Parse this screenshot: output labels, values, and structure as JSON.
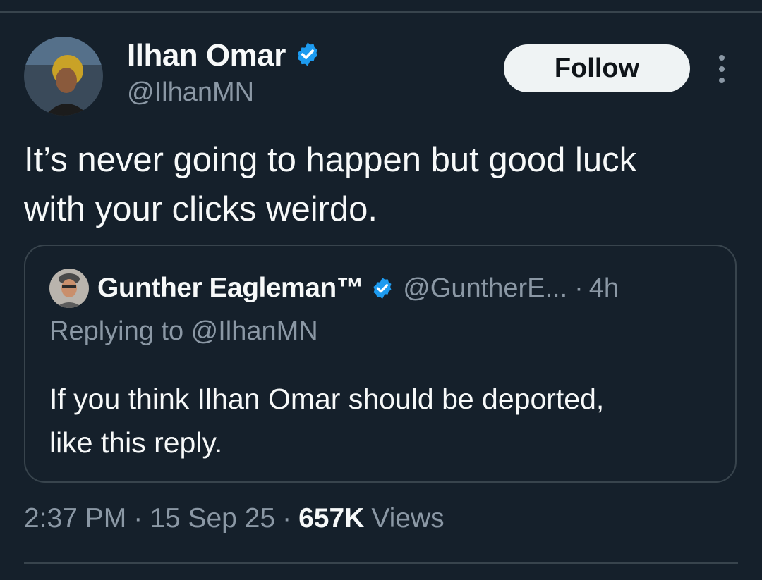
{
  "tweet": {
    "author": {
      "name": "Ilhan Omar",
      "handle": "@IlhanMN",
      "verified": true,
      "verified_color": "#1d9bf0"
    },
    "follow_label": "Follow",
    "more_icon": "more-horizontal-icon",
    "text_lines": [
      "It’s never going to happen but good luck",
      "with your clicks weirdo."
    ],
    "quoted": {
      "name": "Gunther Eagleman™",
      "verified": true,
      "handle": "@GuntherE...",
      "separator": "·",
      "time": "4h",
      "replying_to": "Replying to @IlhanMN",
      "text_lines": [
        "If you think Ilhan Omar should be deported,",
        "like this reply."
      ]
    },
    "meta": {
      "time": "2:37 PM",
      "separator": "·",
      "date": "15 Sep 25",
      "views_count": "657K",
      "views_label": "Views"
    }
  },
  "colors": {
    "background": "#15202b",
    "text_primary": "#f7f9f9",
    "text_secondary": "#8b98a5",
    "border": "#38444d",
    "follow_bg": "#eff3f4"
  }
}
